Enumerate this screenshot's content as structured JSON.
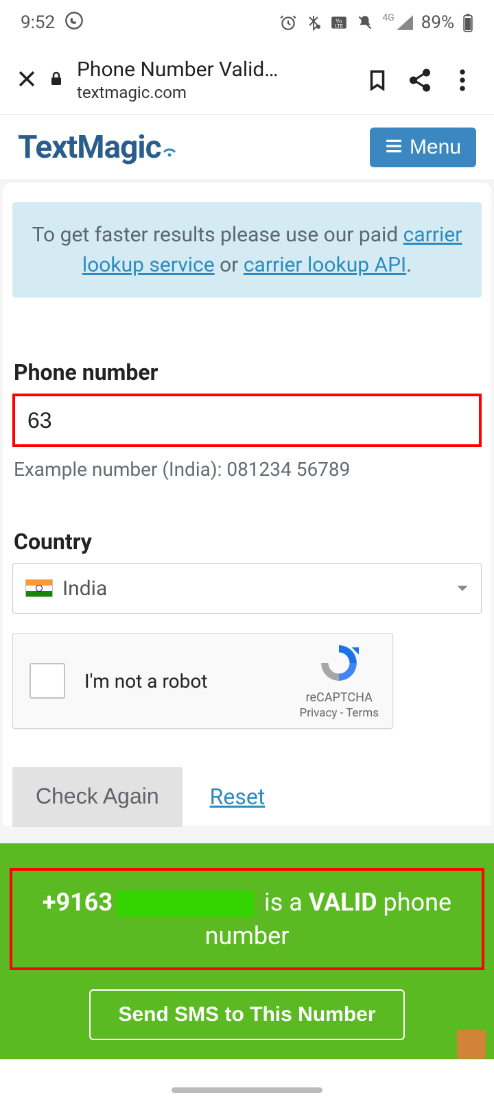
{
  "status": {
    "time": "9:52",
    "battery": "89%",
    "net_label": "4G"
  },
  "browser": {
    "title": "Phone Number Valid…",
    "domain": "textmagic.com"
  },
  "header": {
    "brand": "TextMagic",
    "menu_label": "Menu"
  },
  "notice": {
    "pre": "To get faster results please use our paid ",
    "link1": "carrier lookup service",
    "mid": " or ",
    "link2": "carrier lookup API",
    "post": "."
  },
  "form": {
    "phone_label": "Phone number",
    "phone_value": "63",
    "example": "Example number (India): 081234 56789",
    "country_label": "Country",
    "country_value": "India",
    "recaptcha_label": "I'm not a robot",
    "recaptcha_brand": "reCAPTCHA",
    "recaptcha_links": "Privacy - Terms",
    "check_label": "Check Again",
    "reset_label": "Reset"
  },
  "result": {
    "number_prefix": "+9163",
    "mid": " is a ",
    "valid_word": "VALID",
    "tail": " phone number",
    "send_label": "Send SMS to This Number"
  }
}
